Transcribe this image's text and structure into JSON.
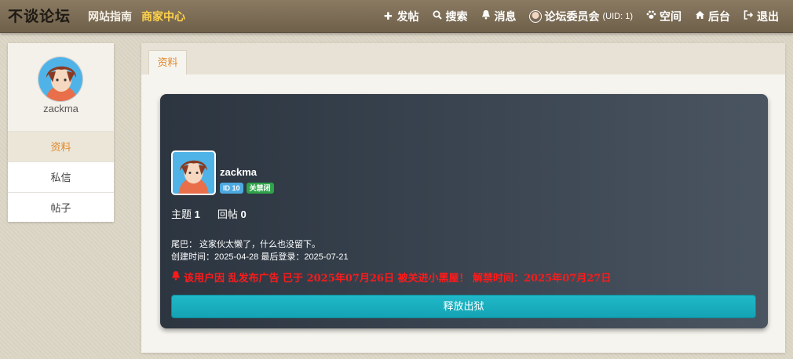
{
  "nav": {
    "logo": "不谈论坛",
    "links": [
      {
        "label": "网站指南"
      },
      {
        "label": "商家中心"
      }
    ],
    "right": {
      "post": "发帖",
      "search": "搜索",
      "messages": "消息",
      "user": "论坛委员会",
      "uid": "(UID: 1)",
      "space": "空间",
      "admin": "后台",
      "logout": "退出"
    }
  },
  "sidebar": {
    "username": "zackma",
    "items": [
      {
        "label": "资料"
      },
      {
        "label": "私信"
      },
      {
        "label": "帖子"
      }
    ]
  },
  "main": {
    "tab": "资料"
  },
  "profile": {
    "username": "zackma",
    "id_badge": "ID 10",
    "status_badge": "关禁闭",
    "topics_label": "主题",
    "topics": "1",
    "replies_label": "回帖",
    "replies": "0",
    "signature": "尾巴： 这家伙太懒了，什么也没留下。",
    "dates": "创建时间：2025-04-28  最后登录：2025-07-21",
    "alert": "该用户因 乱发布广告 已于 2025年07月26日 被关进小黑屋！ 解禁时间：2025年07月27日",
    "release_button": "释放出狱"
  }
}
